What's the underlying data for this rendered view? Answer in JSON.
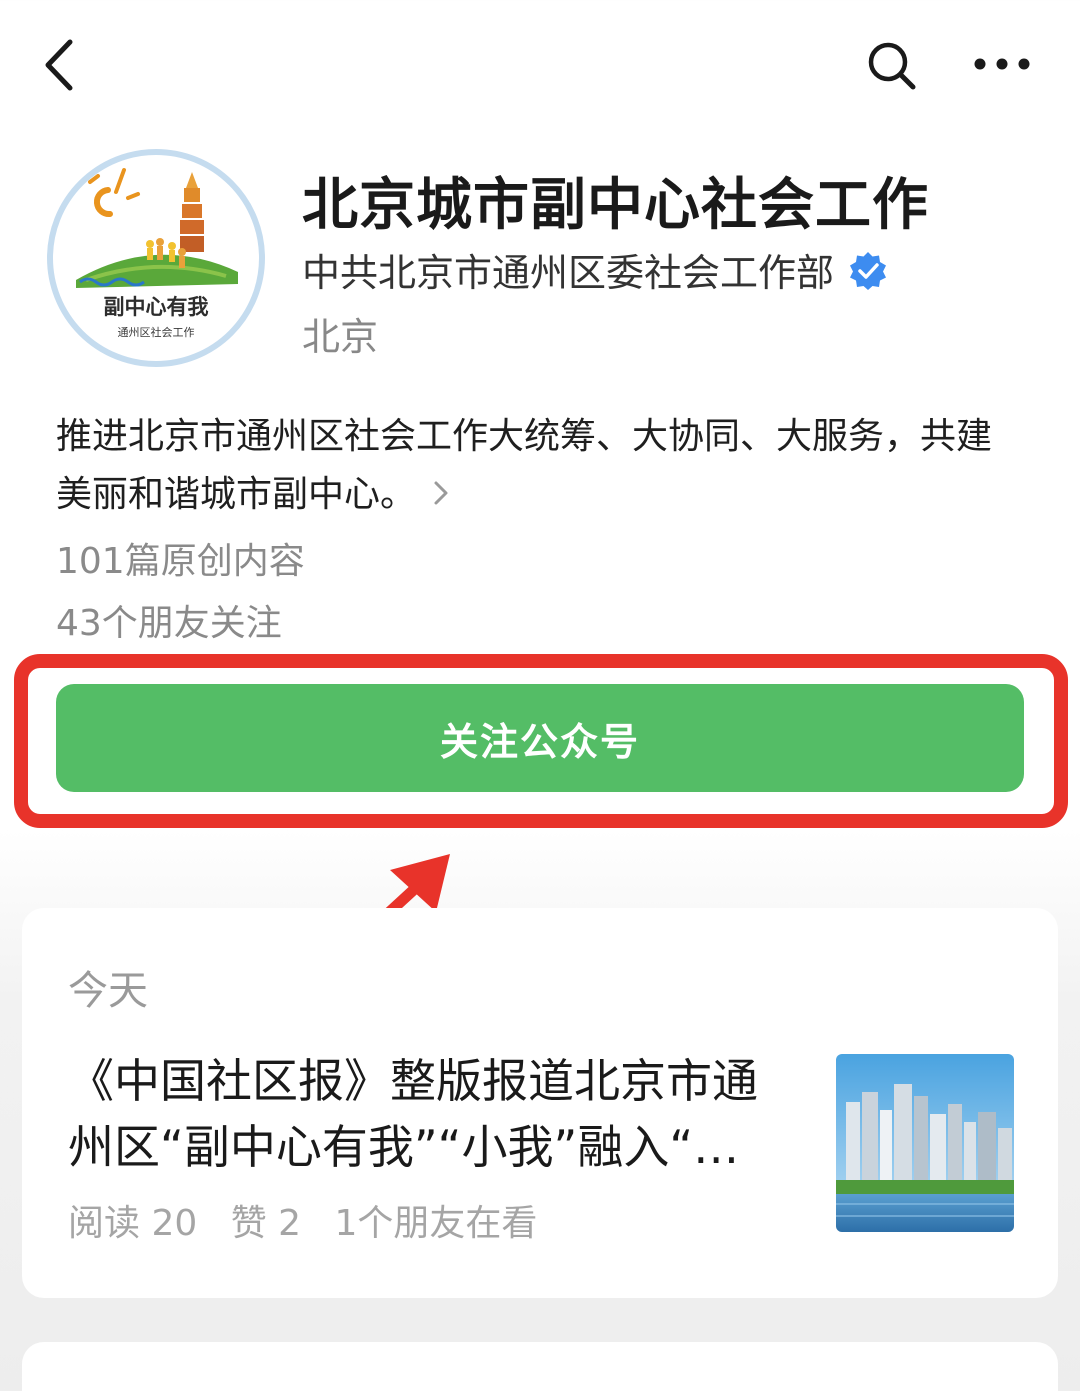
{
  "nav": {
    "back_icon": "chevron-left-icon",
    "search_icon": "search-icon",
    "more_icon": "more-dots-icon"
  },
  "profile": {
    "avatar_icon": "account-logo",
    "avatar_logo_text": "副中心有我",
    "avatar_logo_subtext": "通州区社会工作",
    "name": "北京城市副中心社会工作",
    "owner": "中共北京市通州区委社会工作部",
    "verified_icon": "verified-badge-icon",
    "location": "北京",
    "description": "推进北京市通州区社会工作大统筹、大协同、大服务，共建美丽和谐城市副中心。",
    "original_count": "101篇原创内容",
    "friends_following": "43个朋友关注"
  },
  "follow_button": {
    "label": "关注公众号",
    "color": "#54bd66"
  },
  "annotation": {
    "highlight_color": "#e8332a"
  },
  "feed": {
    "date_label": "今天",
    "articles": [
      {
        "title_line1": "《中国社区报》整版报道北京市通",
        "title_line2": "州区“副中心有我”“小我”融入“…",
        "reads": "阅读 20",
        "likes": "赞 2",
        "friends_viewing": "1个朋友在看",
        "thumbnail": "city-skyline-thumbnail"
      }
    ]
  }
}
